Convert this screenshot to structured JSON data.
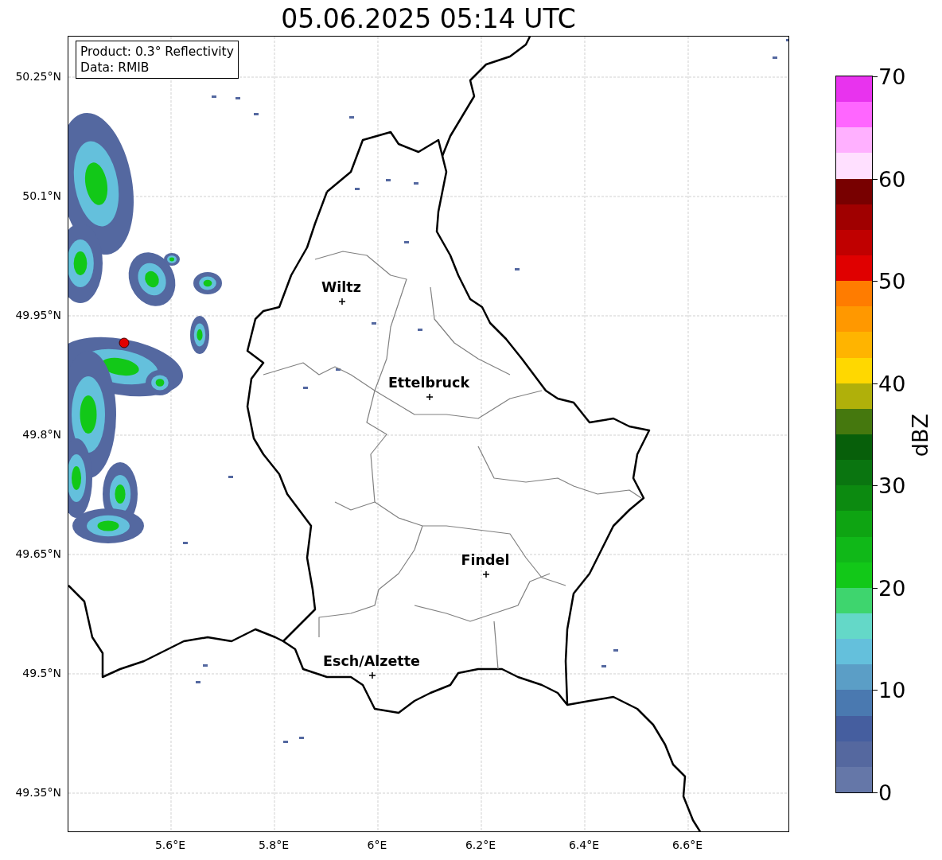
{
  "title": "05.06.2025 05:14 UTC",
  "info": [
    "Product: 0.3° Reflectivity",
    "Data: RMIB"
  ],
  "cities": [
    {
      "name": "Wiltz"
    },
    {
      "name": "Ettelbruck"
    },
    {
      "name": "Findel"
    },
    {
      "name": "Esch/Alzette"
    }
  ],
  "lat_ticks": [
    "50.25°N",
    "50.1°N",
    "49.95°N",
    "49.8°N",
    "49.65°N",
    "49.5°N",
    "49.35°N"
  ],
  "lon_ticks": [
    "5.6°E",
    "5.8°E",
    "6°E",
    "6.2°E",
    "6.4°E",
    "6.6°E"
  ],
  "colorbar": {
    "label": "dBZ",
    "ticks": [
      "70",
      "60",
      "50",
      "40",
      "30",
      "20",
      "10",
      "0"
    ],
    "bands": [
      {
        "color": "#6577a8"
      },
      {
        "color": "#55689f"
      },
      {
        "color": "#455e9f"
      },
      {
        "color": "#4a79b0"
      },
      {
        "color": "#5b9ec6"
      },
      {
        "color": "#64c0dc"
      },
      {
        "color": "#64d8c8"
      },
      {
        "color": "#3ed56e"
      },
      {
        "color": "#12c818"
      },
      {
        "color": "#10b818"
      },
      {
        "color": "#0ea412"
      },
      {
        "color": "#0c8a10"
      },
      {
        "color": "#0a7510"
      },
      {
        "color": "#075f0a"
      },
      {
        "color": "#45780e"
      },
      {
        "color": "#b0b00a"
      },
      {
        "color": "#ffd800"
      },
      {
        "color": "#ffb400"
      },
      {
        "color": "#ff9800"
      },
      {
        "color": "#ff7c00"
      },
      {
        "color": "#e00000"
      },
      {
        "color": "#c00000"
      },
      {
        "color": "#a00000"
      },
      {
        "color": "#780000"
      },
      {
        "color": "#ffe0ff"
      },
      {
        "color": "#ffb0ff"
      },
      {
        "color": "#ff66ff"
      },
      {
        "color": "#e833ee"
      }
    ]
  }
}
